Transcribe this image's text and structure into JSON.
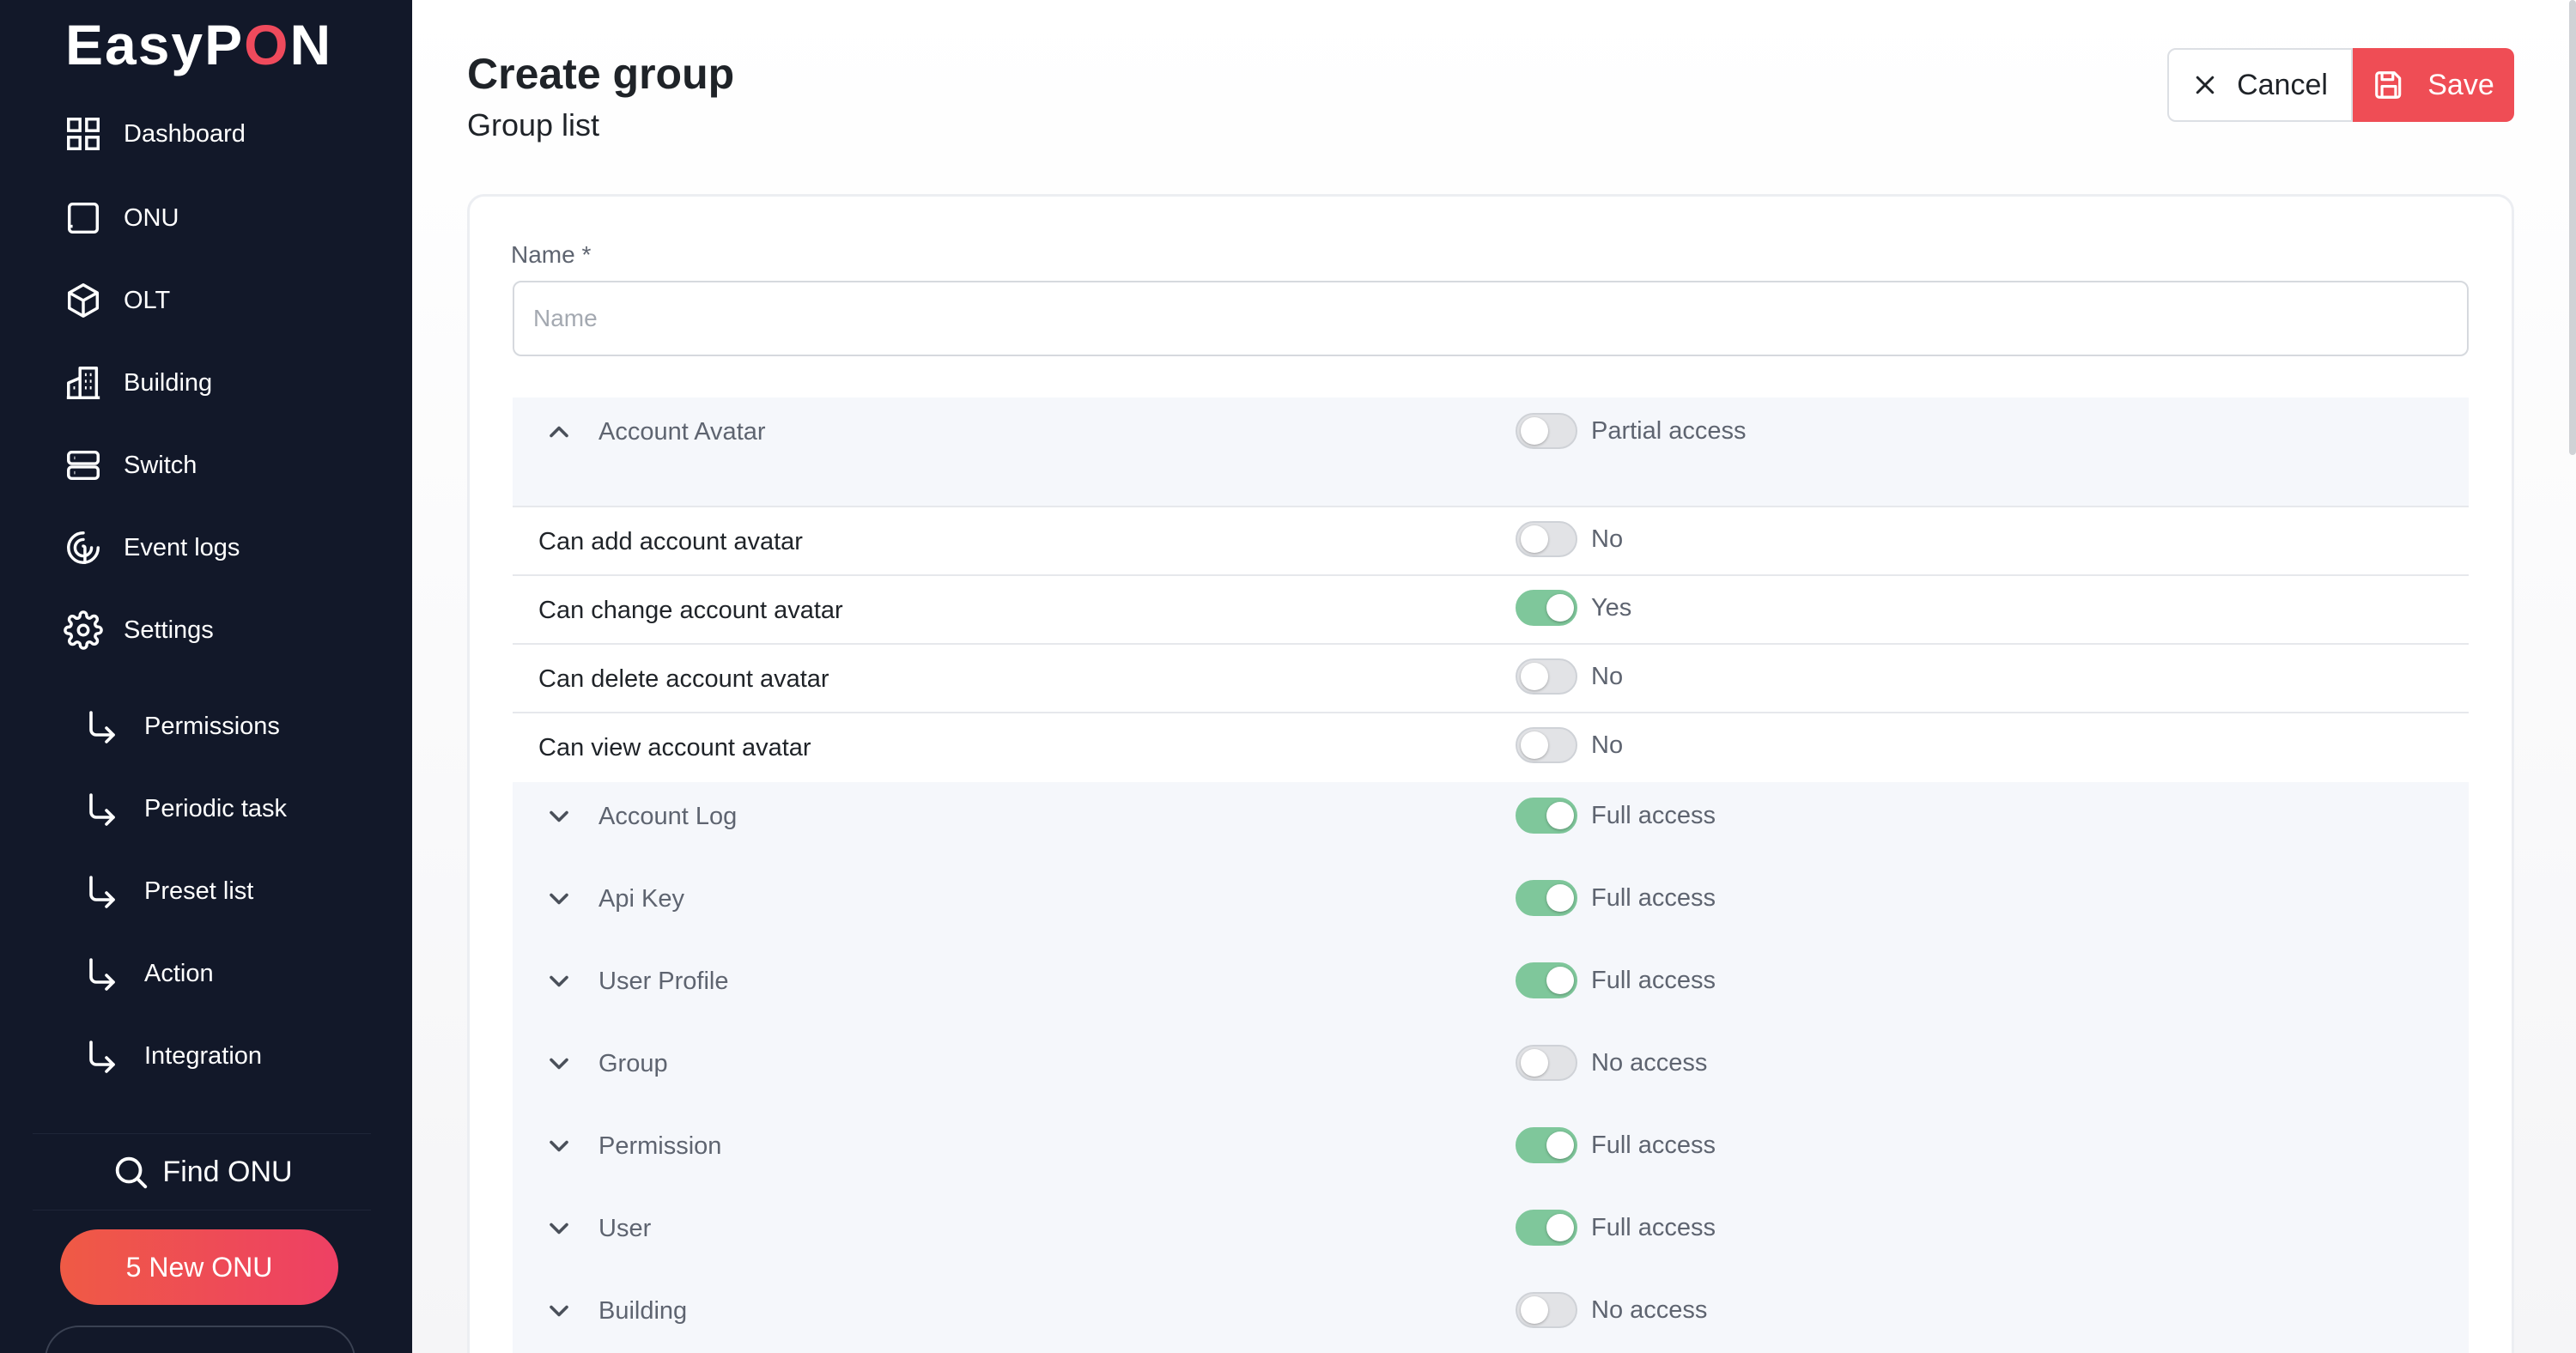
{
  "app": {
    "logo_pre": "EasyP",
    "logo_o": "O",
    "logo_post": "N"
  },
  "sidebar": {
    "items": [
      {
        "label": "Dashboard",
        "icon": "grid-icon"
      },
      {
        "label": "ONU",
        "icon": "square-icon"
      },
      {
        "label": "OLT",
        "icon": "cube-icon"
      },
      {
        "label": "Building",
        "icon": "building-icon"
      },
      {
        "label": "Switch",
        "icon": "server-icon"
      },
      {
        "label": "Event logs",
        "icon": "fingerprint-icon"
      },
      {
        "label": "Settings",
        "icon": "gear-icon"
      }
    ],
    "sub_items": [
      {
        "label": "Permissions",
        "icon": "arrow-down-right-icon"
      },
      {
        "label": "Periodic task",
        "icon": "arrow-down-right-icon"
      },
      {
        "label": "Preset list",
        "icon": "arrow-down-right-icon"
      },
      {
        "label": "Action",
        "icon": "arrow-down-right-icon"
      },
      {
        "label": "Integration",
        "icon": "arrow-down-right-icon"
      }
    ],
    "find_onu": "Find ONU",
    "new_onu": "5 New ONU"
  },
  "header": {
    "title": "Create group",
    "subtitle": "Group list",
    "cancel_label": "Cancel",
    "save_label": "Save"
  },
  "form": {
    "name_label": "Name *",
    "name_placeholder": "Name",
    "name_value": ""
  },
  "permissions": {
    "account_avatar": {
      "name": "Account Avatar",
      "status": "Partial access",
      "enabled": false,
      "expanded": true,
      "perms": [
        {
          "name": "Can add account avatar",
          "status": "No",
          "enabled": false
        },
        {
          "name": "Can change account avatar",
          "status": "Yes",
          "enabled": true
        },
        {
          "name": "Can delete account avatar",
          "status": "No",
          "enabled": false
        },
        {
          "name": "Can view account avatar",
          "status": "No",
          "enabled": false
        }
      ]
    },
    "groups": [
      {
        "name": "Account Log",
        "status": "Full access",
        "enabled": true
      },
      {
        "name": "Api Key",
        "status": "Full access",
        "enabled": true
      },
      {
        "name": "User Profile",
        "status": "Full access",
        "enabled": true
      },
      {
        "name": "Group",
        "status": "No access",
        "enabled": false
      },
      {
        "name": "Permission",
        "status": "Full access",
        "enabled": true
      },
      {
        "name": "User",
        "status": "Full access",
        "enabled": true
      },
      {
        "name": "Building",
        "status": "No access",
        "enabled": false
      }
    ]
  },
  "colors": {
    "sidebar_bg": "#121829",
    "accent": "#ef4d55",
    "toggle_on": "#7fc79b"
  }
}
